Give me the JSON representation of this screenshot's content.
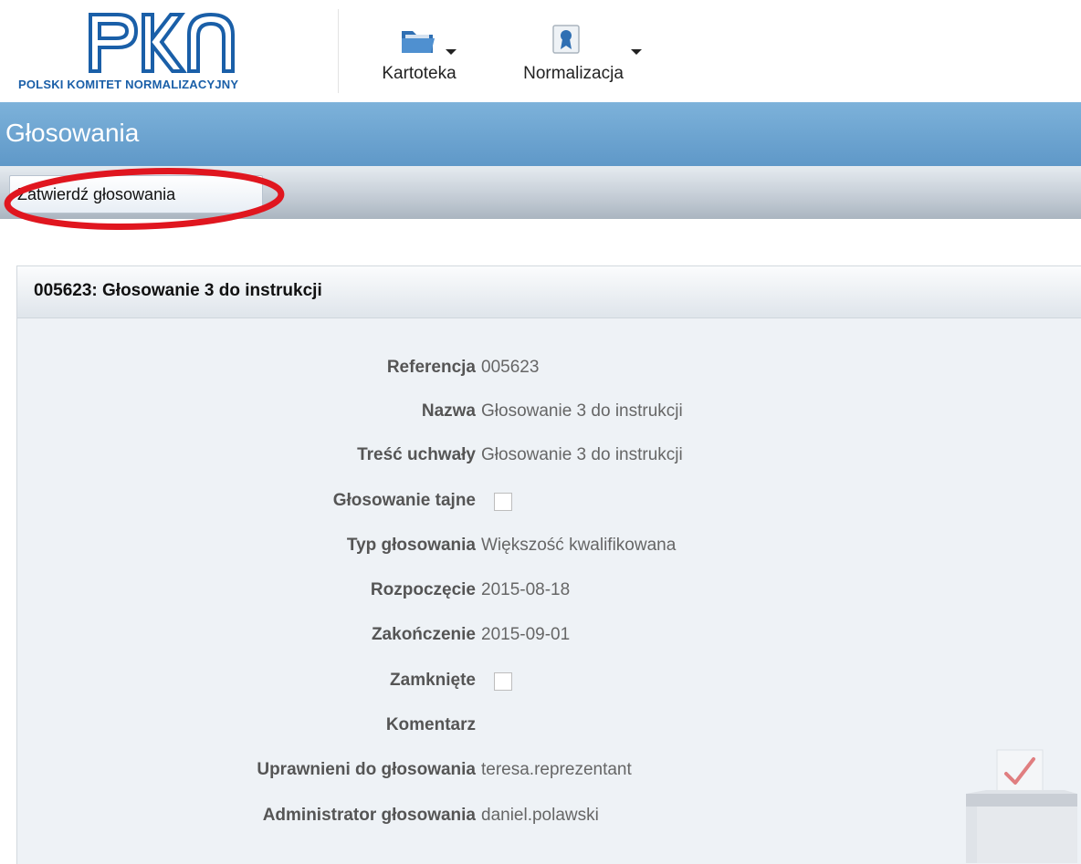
{
  "header": {
    "logo_text": "POLSKI KOMITET NORMALIZACYJNY",
    "logo_mark": "PKN",
    "menu": [
      {
        "label": "Kartoteka",
        "icon": "folder-icon"
      },
      {
        "label": "Normalizacja",
        "icon": "certificate-icon"
      }
    ]
  },
  "page": {
    "title": "Głosowania"
  },
  "toolbar": {
    "approve_label": "Zatwierdź głosowania"
  },
  "panel": {
    "title": "005623: Głosowanie 3 do instrukcji",
    "fields": [
      {
        "label": "Referencja",
        "value": "005623"
      },
      {
        "label": "Nazwa",
        "value": "Głosowanie 3 do instrukcji"
      },
      {
        "label": "Treść uchwały",
        "value": "Głosowanie 3 do instrukcji"
      },
      {
        "label": "Głosowanie tajne",
        "checked": false
      },
      {
        "label": "Typ głosowania",
        "value": "Większość kwalifikowana"
      },
      {
        "label": "Rozpoczęcie",
        "value": "2015-08-18"
      },
      {
        "label": "Zakończenie",
        "value": "2015-09-01"
      },
      {
        "label": "Zamknięte",
        "checked": false
      },
      {
        "label": "Komentarz",
        "value": ""
      },
      {
        "label": "Uprawnieni do głosowania",
        "value": "teresa.reprezentant"
      },
      {
        "label": "Administrator głosowania",
        "value": "daniel.polawski"
      }
    ]
  },
  "colors": {
    "title_bar": "#6aa3d0",
    "highlight": "#e0161f",
    "logo_blue": "#1a5fa8"
  }
}
